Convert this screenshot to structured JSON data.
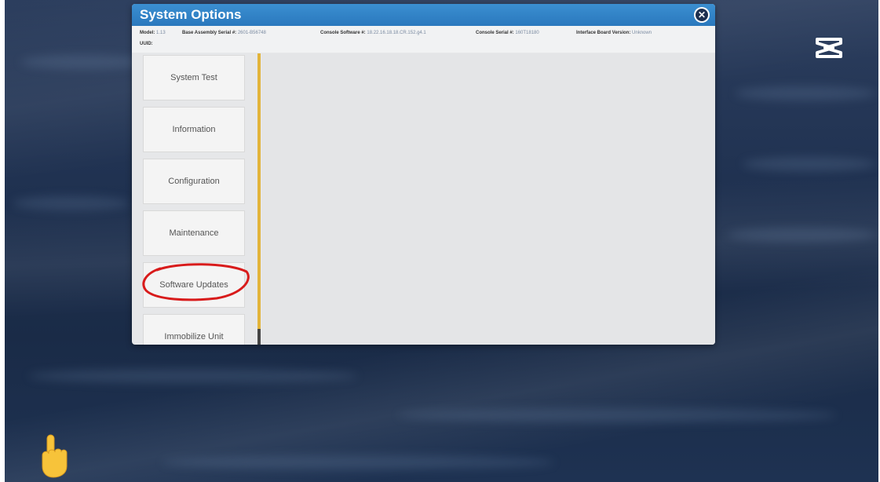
{
  "dialog": {
    "title": "System Options",
    "close_icon": "close-circle-icon",
    "info": {
      "model_label": "Model:",
      "model_value": "1.13",
      "base_serial_label": "Base Assembly Serial #:",
      "base_serial_value": "2601-B56748",
      "console_software_label": "Console Software #:",
      "console_software_value": "18.22.16.18.18.CR.152.g4.1",
      "console_serial_label": "Console Serial #:",
      "console_serial_value": "160T18180",
      "interface_board_label": "Interface Board Version:",
      "interface_board_value": "Unknown",
      "uuid_label": "UUID:"
    }
  },
  "menu": {
    "items": [
      {
        "label": "System Test"
      },
      {
        "label": "Information"
      },
      {
        "label": "Configuration"
      },
      {
        "label": "Maintenance"
      },
      {
        "label": "Software Updates"
      },
      {
        "label": "Immobilize Unit"
      }
    ],
    "highlighted_item": "Software Updates",
    "annotation_color": "#d81b1b"
  },
  "overlay": {
    "capcut_icon": "capcut-logo-icon",
    "hand_icon": "pointing-hand-icon"
  },
  "colors": {
    "header": "#2a78bd",
    "scroll_track": "#e2b43b",
    "desktop": "#1f3150"
  }
}
